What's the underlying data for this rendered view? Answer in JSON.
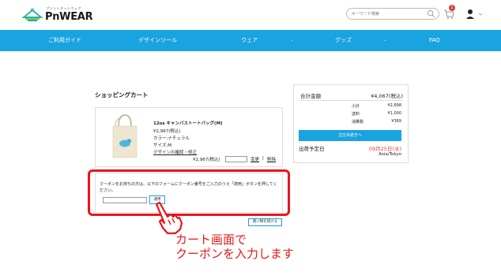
{
  "header": {
    "logo_small": "プリントネットウェア",
    "logo_text": "PnWEAR",
    "search_placeholder": "キーワード検索",
    "cart_count": "1"
  },
  "nav": {
    "items": [
      {
        "label": "ご利用ガイド"
      },
      {
        "label": "デザインツール"
      },
      {
        "label": "ウェア"
      },
      {
        "label": "グッズ"
      },
      {
        "label": "FAQ"
      }
    ],
    "caret": "⌄"
  },
  "cart": {
    "title": "ショッピングカート",
    "item": {
      "name": "12oz キャンバストートバッグ(M)",
      "price": "¥2,967(税込)",
      "color": "カラー:ナチュラル",
      "size": "サイズ:M",
      "design_link": "デザインの確認・修正",
      "subtotal": "¥2,967(税込)",
      "quantity": "",
      "change_label": "変更",
      "separator": "|",
      "delete_label": "削除"
    },
    "coupon": {
      "text": "クーポンをお持ちの方は、以下のフォームにクーポン番号をご入力のうえ「適用」ボタンを押してください。",
      "value": "",
      "apply_label": "適用"
    },
    "continue_label": "買い物を続ける"
  },
  "summary": {
    "total_label": "合計金額",
    "total_value": "¥4,067(税込)",
    "rows": [
      {
        "label": "小計",
        "value": "¥2,698"
      },
      {
        "label": "送料",
        "value": "¥1,000"
      },
      {
        "label": "消費税",
        "value": "¥369"
      }
    ],
    "order_button": "注文手続きへ",
    "ship_label": "出荷予定日",
    "ship_date": "09月25日(水)",
    "ship_tz": "Asia/Tokyo"
  },
  "annotation": {
    "line1": "カート画面で",
    "line2": "クーポンを入力します"
  },
  "colors": {
    "brand_blue": "#19a3e0",
    "highlight_red": "#e8161c",
    "badge_red": "#e23a3a"
  },
  "icons": [
    "hanger-logo-icon",
    "search-icon",
    "cart-icon",
    "user-icon",
    "chevron-down-icon",
    "pointing-hand-icon",
    "tote-bag-image"
  ]
}
